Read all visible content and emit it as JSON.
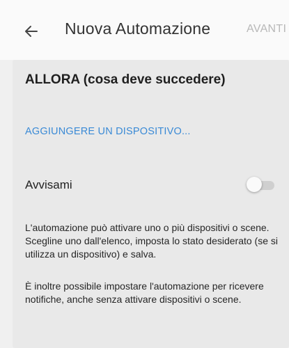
{
  "header": {
    "title": "Nuova Automazione",
    "next_label": "AVANTI",
    "back_icon": "arrow-left-icon"
  },
  "then_section": {
    "title": "ALLORA (cosa deve succedere)",
    "add_device_label": "AGGIUNGERE UN DISPOSITIVO...",
    "notify_label": "Avvisami",
    "notify_enabled": false,
    "help_text_1": "L'automazione può attivare uno o più dispositivi o scene. Scegline uno dall'elenco, imposta lo stato desiderato (se si utilizza un dispositivo) e salva.",
    "help_text_2": "È inoltre possibile impostare l'automazione per ricevere notifiche, anche senza attivare dispositivi o scene."
  },
  "colors": {
    "link": "#3a8ad6",
    "disabled_action": "#b8b8b8",
    "card_background": "#e9e9e9"
  }
}
